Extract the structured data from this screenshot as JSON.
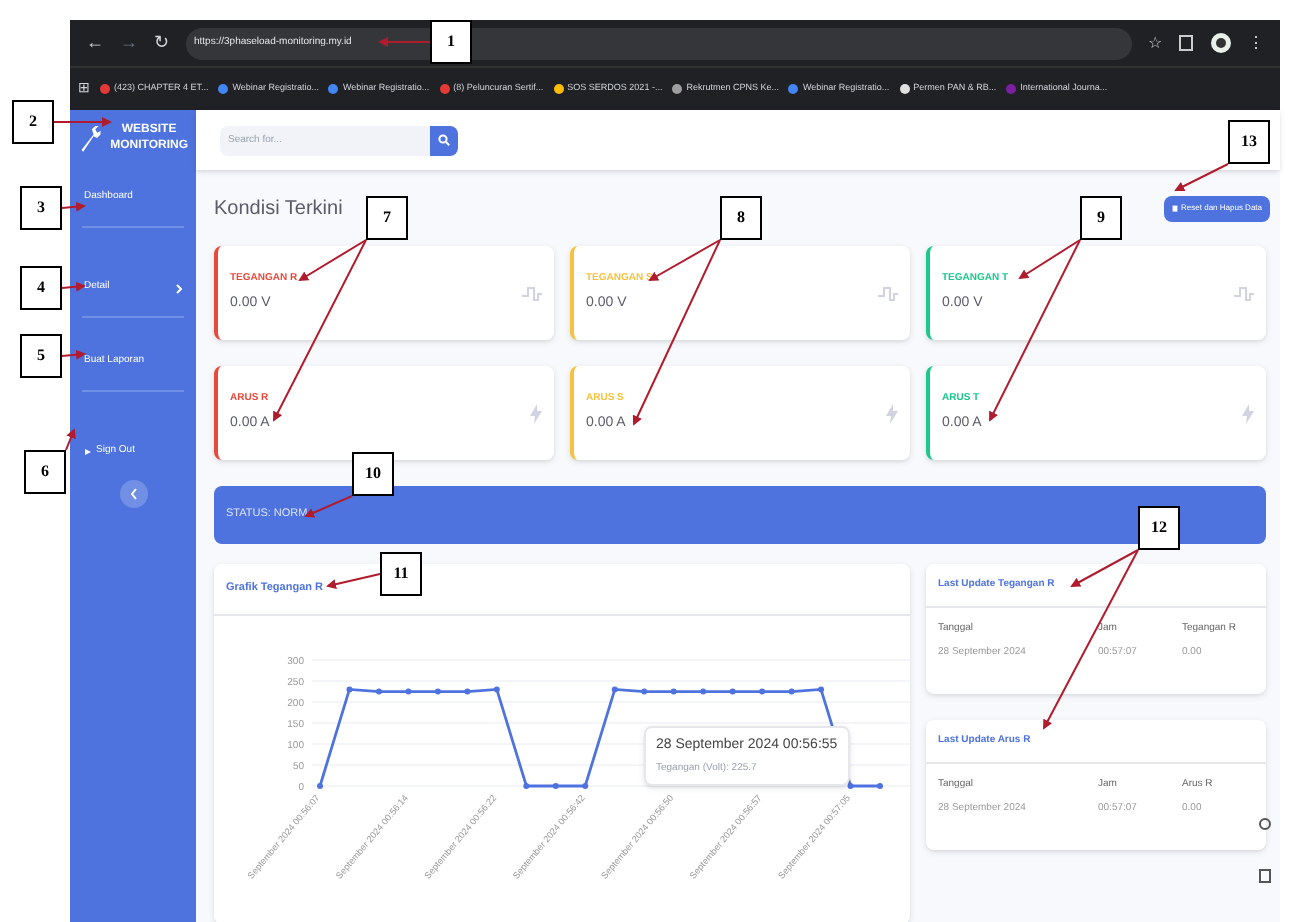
{
  "browser": {
    "url": "https://3phaseload-monitoring.my.id",
    "bookmarks": [
      "(423) CHAPTER 4 ET...",
      "Webinar Registratio...",
      "Webinar Registratio...",
      "(8) Peluncuran Sertif...",
      "SOS SERDOS 2021 -...",
      "Rekrutmen CPNS Ke...",
      "Webinar Registratio...",
      "Permen PAN & RB...",
      "International Journa..."
    ]
  },
  "sidebar": {
    "brand": [
      "WEBSITE",
      "MONITORING"
    ],
    "items": [
      {
        "label": "Dashboard",
        "kind": "link"
      },
      {
        "label": "Detail",
        "kind": "submenu"
      },
      {
        "label": "Buat Laporan",
        "kind": "link"
      },
      {
        "label": "Sign Out",
        "kind": "signout"
      }
    ]
  },
  "search": {
    "placeholder": "Search for..."
  },
  "heading": "Kondisi Terkini",
  "reset_button": "Reset dan Hapus Data",
  "cards": [
    {
      "label": "TEGANGAN R",
      "value": "0.00 V",
      "color": "#e74a3b",
      "kind": "wave"
    },
    {
      "label": "TEGANGAN S",
      "value": "0.00 V",
      "color": "#f6c23e",
      "kind": "wave"
    },
    {
      "label": "TEGANGAN T",
      "value": "0.00 V",
      "color": "#1cc88a",
      "kind": "wave"
    },
    {
      "label": "ARUS R",
      "value": "0.00 A",
      "color": "#e74a3b",
      "kind": "bolt"
    },
    {
      "label": "ARUS S",
      "value": "0.00 A",
      "color": "#f6c23e",
      "kind": "bolt"
    },
    {
      "label": "ARUS T",
      "value": "0.00 A",
      "color": "#1cc88a",
      "kind": "bolt"
    }
  ],
  "status": "STATUS: NORM",
  "chart": {
    "title": "Grafik Tegangan R",
    "tooltip": {
      "title": "28 September 2024 00:56:55",
      "text": "Tegangan (Volt): 225.7"
    },
    "chart_data": {
      "type": "line",
      "categories": [
        "September 2024 00:56:07",
        null,
        null,
        "September 2024 00:56:14",
        null,
        null,
        "September 2024 00:56:22",
        null,
        null,
        "September 2024 00:56:42",
        null,
        null,
        "September 2024 00:56:50",
        null,
        null,
        "September 2024 00:56:57",
        null,
        null,
        "September 2024 00:57:05",
        null
      ],
      "grid": true,
      "series": [
        {
          "color": "#4e73df",
          "marker": "circle",
          "values": [
            0,
            230,
            225,
            225,
            225,
            225,
            230,
            0,
            0,
            0,
            230,
            225,
            225,
            225,
            225,
            225,
            225,
            230,
            0,
            0
          ]
        }
      ],
      "ylim": [
        0,
        300
      ],
      "yticks": [
        0,
        50,
        100,
        150,
        200,
        250,
        300
      ]
    }
  },
  "browser_icons": {
    "back": "←",
    "forward": "→",
    "reload": "↻",
    "star": "☆",
    "menu": "⋮",
    "apps": "⊞"
  },
  "last_updates": [
    {
      "title": "Last Update Tegangan R",
      "columns": [
        "Tanggal",
        "Jam",
        "Tegangan R"
      ],
      "row": [
        "28 September 2024",
        "00:57:07",
        "0.00"
      ]
    },
    {
      "title": "Last Update Arus R",
      "columns": [
        "Tanggal",
        "Jam",
        "Arus R"
      ],
      "row": [
        "28 September 2024",
        "00:57:07",
        "0.00"
      ]
    }
  ],
  "callouts": [
    "1",
    "2",
    "3",
    "4",
    "5",
    "6",
    "7",
    "8",
    "9",
    "10",
    "11",
    "12",
    "13"
  ]
}
